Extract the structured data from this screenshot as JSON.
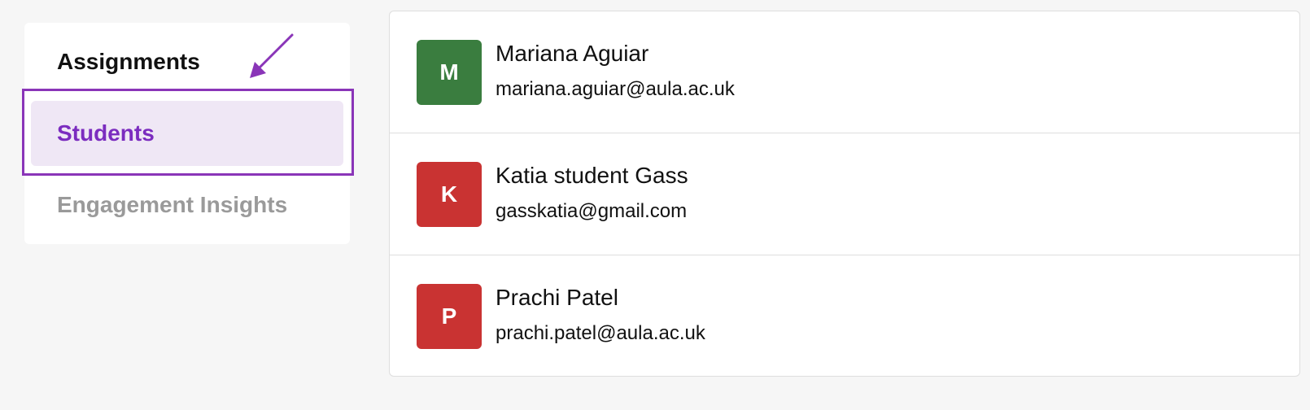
{
  "sidebar": {
    "items": [
      {
        "label": "Assignments",
        "state": "default"
      },
      {
        "label": "Students",
        "state": "selected"
      },
      {
        "label": "Engagement Insights",
        "state": "disabled"
      }
    ]
  },
  "annotation": {
    "highlight_color": "#8a35b8",
    "arrow_icon": "arrow-down-left-icon"
  },
  "students": [
    {
      "initial": "M",
      "name": "Mariana Aguiar",
      "email": "mariana.aguiar@aula.ac.uk",
      "avatar_color": "#3a7d3f"
    },
    {
      "initial": "K",
      "name": "Katia student Gass",
      "email": "gasskatia@gmail.com",
      "avatar_color": "#c93332"
    },
    {
      "initial": "P",
      "name": "Prachi Patel",
      "email": "prachi.patel@aula.ac.uk",
      "avatar_color": "#c93332"
    }
  ],
  "colors": {
    "accent": "#7b2cbf",
    "selected_bg": "#efe7f5",
    "muted_text": "#9a9a9a"
  }
}
